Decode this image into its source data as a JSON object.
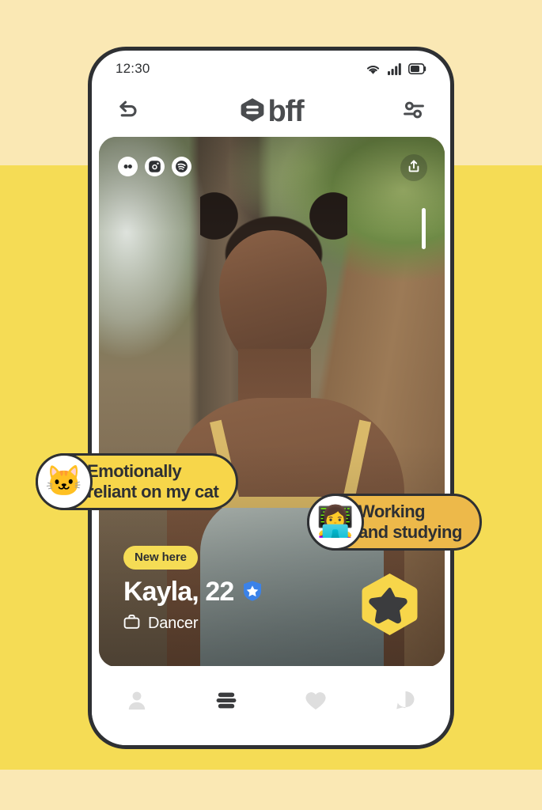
{
  "theme": {
    "background_top": "#FAE8B4",
    "background_mid": "#F5DC55",
    "background_bottom": "#FAE8B4",
    "brand_yellow": "#F7D64A",
    "amber": "#EDB94A",
    "dark": "#2E3033",
    "verified_blue": "#3B82E8"
  },
  "status_bar": {
    "time": "12:30",
    "icons": [
      "wifi-icon",
      "cellular-signal-icon",
      "battery-icon"
    ]
  },
  "app_header": {
    "back_icon": "undo-arrow-icon",
    "brand_logo_icon": "bff-hexagon-logo-icon",
    "brand_name": "bff",
    "filters_icon": "sliders-filter-icon"
  },
  "card": {
    "social_badges": [
      {
        "name": "bumble-badge",
        "icon": "bumble-icon"
      },
      {
        "name": "instagram-badge",
        "icon": "instagram-icon"
      },
      {
        "name": "spotify-badge",
        "icon": "spotify-icon"
      }
    ],
    "share_icon": "share-upload-icon",
    "photo_indicator_count": 1,
    "photo_indicator_active": 1
  },
  "interest_pills": [
    {
      "id": "cat",
      "emoji": "🐱",
      "emoji_name": "cat-face-emoji",
      "text": "Emotionally\nreliant on my cat",
      "background": "#F7D64A"
    },
    {
      "id": "work",
      "emoji": "👩‍💻",
      "emoji_name": "woman-technologist-emoji",
      "text": "Working\nand studying",
      "background": "#EDB94A"
    }
  ],
  "profile": {
    "new_badge": "New here",
    "name_age": "Kayla, 22",
    "verified_icon": "verified-shield-star-icon",
    "occupation_icon": "briefcase-icon",
    "occupation": "Dancer",
    "superswipe_icon": "superswipe-star-hexagon-icon"
  },
  "bottom_nav": {
    "items": [
      {
        "name": "profile",
        "icon": "person-icon",
        "active": false
      },
      {
        "name": "discover",
        "icon": "bff-hive-icon",
        "active": true
      },
      {
        "name": "likes",
        "icon": "heart-icon",
        "active": false
      },
      {
        "name": "chats",
        "icon": "chat-bubble-icon",
        "active": false
      }
    ]
  }
}
